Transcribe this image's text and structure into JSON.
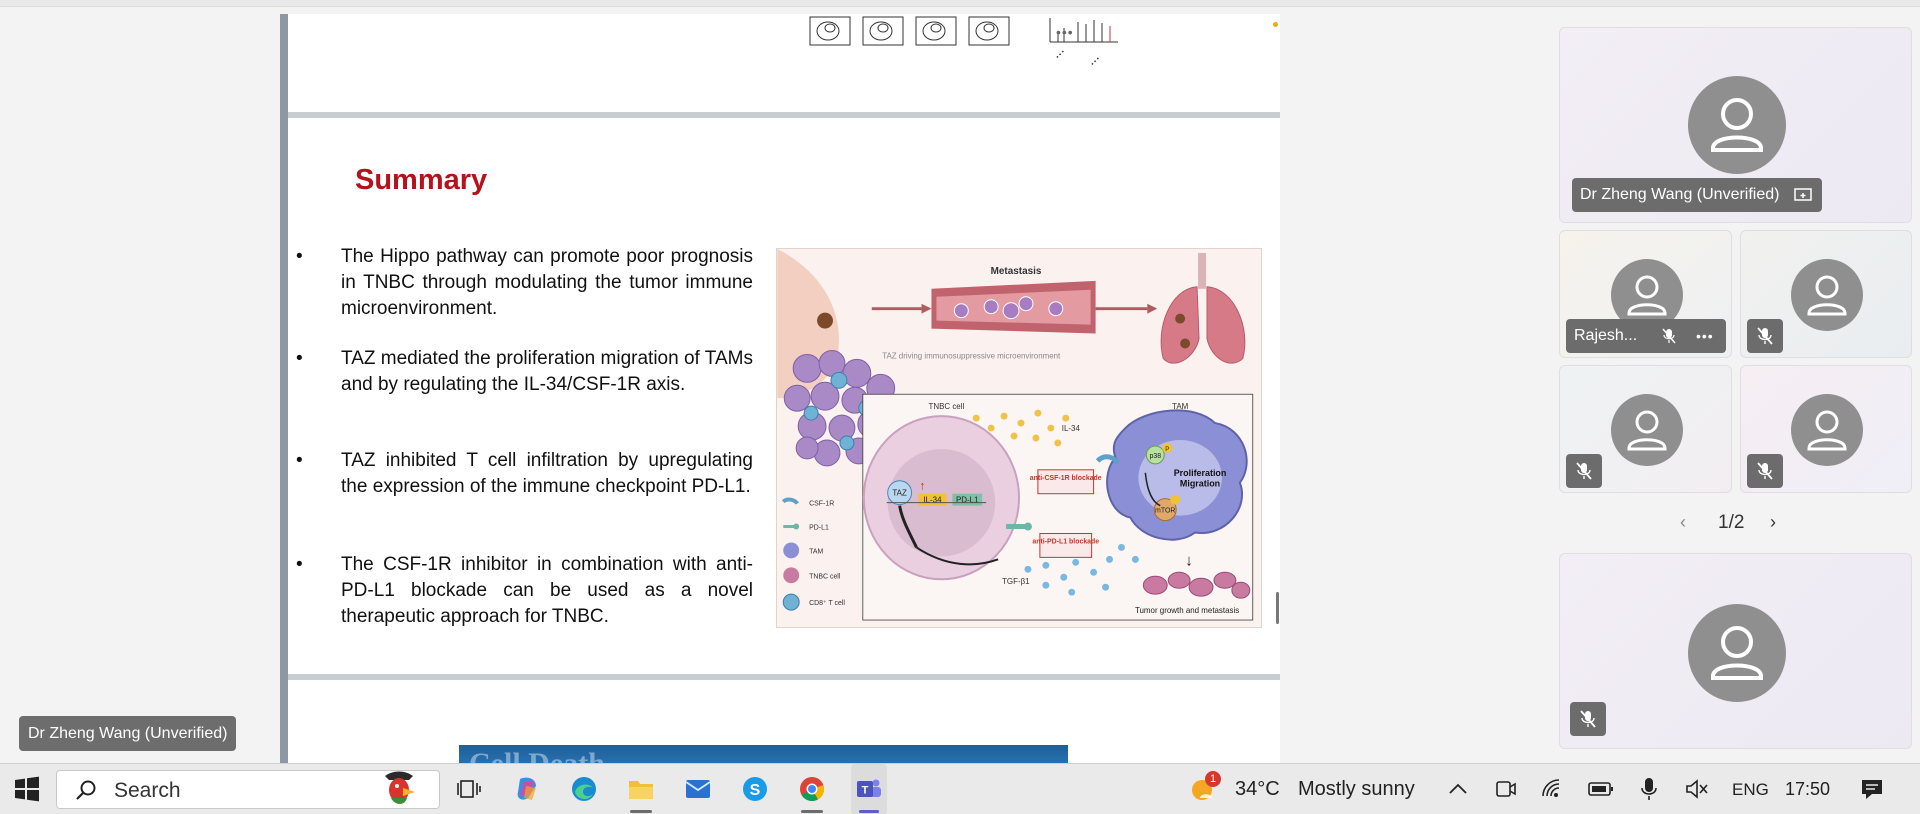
{
  "stage": {
    "presenter_name": "Dr Zheng Wang (Unverified)",
    "slide": {
      "title": "Summary",
      "bullets": [
        "The Hippo pathway can promote poor prognosis in TNBC through modulating the tumor immune microenvironment.",
        "TAZ mediated the proliferation migration of TAMs and by regulating the IL-34/CSF-1R axis.",
        "TAZ inhibited T cell infiltration by upregulating the expression of the immune checkpoint PD-L1.",
        "The CSF-1R inhibitor in combination with anti-PD-L1 blockade can be used as a novel therapeutic approach for TNBC."
      ],
      "bullet_symbol": "•",
      "figure": {
        "metastasis": "Metastasis",
        "taz_driving": "TAZ driving immunosuppressive microenvironment",
        "tnbc_cell": "TNBC cell",
        "tam": "TAM",
        "il34_top": "IL-34",
        "taz": "TAZ",
        "il34": "IL-34",
        "pdl1": "PD-L1",
        "p38": "p38",
        "p": "P",
        "prolif": "Proliferation",
        "migration": "Migration",
        "mtor": "mTOR",
        "anti_csf": "anti-CSF-1R blockade",
        "anti_pdl1": "anti-PD-L1 blockade",
        "tgf": "TGF-β1",
        "tumor_growth": "Tumor growth and metastasis",
        "legend": [
          "CSF-1R",
          "PD-L1",
          "TAM",
          "TNBC cell",
          "CD8⁺ T cell"
        ]
      },
      "next_slide_text": "Cell Death"
    },
    "more_options": "•••"
  },
  "participants": {
    "featured": {
      "name": "Dr Zheng Wang (Unverified)"
    },
    "tiles": [
      {
        "name": "Rajesh...",
        "more": "•••"
      },
      {
        "name": ""
      },
      {
        "name": ""
      },
      {
        "name": ""
      }
    ],
    "pager": {
      "label": "1/2",
      "prev": "‹",
      "next": "›"
    }
  },
  "taskbar": {
    "search_placeholder": "Search",
    "weather_temp": "34°C",
    "weather_desc": "Mostly sunny",
    "weather_badge": "1",
    "language": "ENG",
    "time": "17:50",
    "tray_chevron": "^"
  },
  "colors": {
    "accent_red": "#b5121b",
    "taskbar_bg": "#eaeaea",
    "chip_bg": "#6c6c6c"
  }
}
